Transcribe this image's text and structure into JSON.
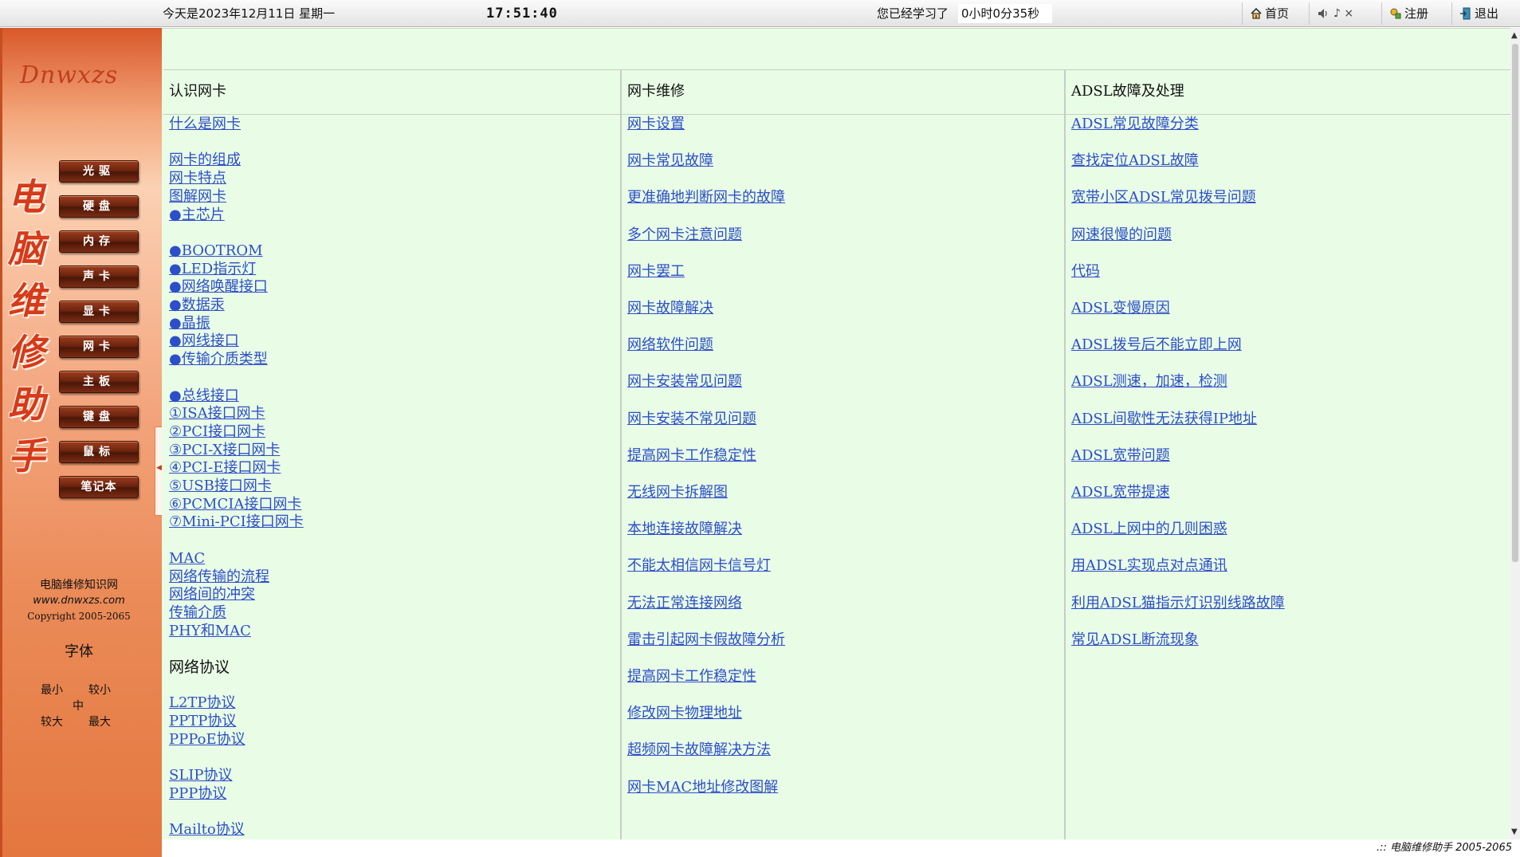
{
  "topbar": {
    "date_text": "今天是2023年12月11日 星期一",
    "clock": "17:51:40",
    "study_label": "您已经学习了",
    "study_time": "0小时0分35秒",
    "home_label": "首页",
    "sound_symbols": "♪ ×",
    "register_label": "注册",
    "exit_label": "退出"
  },
  "sidebar": {
    "logo": "Dnwxzs",
    "vertical_title": [
      "电",
      "脑",
      "维",
      "修",
      "助",
      "手"
    ],
    "nav": [
      "光驱",
      "硬盘",
      "内存",
      "声卡",
      "显卡",
      "网卡",
      "主板",
      "键盘",
      "鼠标",
      "笔记本"
    ],
    "site_name": "电脑维修知识网",
    "site_url": "www.dnwxzs.com",
    "copyright": "Copyright 2005-2065",
    "font_title": "字体",
    "font_sizes": {
      "smallest": "最小",
      "smaller": "较小",
      "medium": "中",
      "larger": "较大",
      "largest": "最大"
    }
  },
  "main": {
    "columns": [
      {
        "header": "认识网卡",
        "items": [
          {
            "text": "什么是网卡",
            "type": "link",
            "row": 0
          },
          {
            "text": "网卡的组成",
            "type": "link",
            "row": 2
          },
          {
            "text": "网卡特点",
            "type": "link",
            "row": 3
          },
          {
            "text": "图解网卡",
            "type": "link",
            "row": 4
          },
          {
            "text": "●主芯片",
            "type": "link",
            "row": 5
          },
          {
            "text": "●BOOTROM",
            "type": "link",
            "row": 7
          },
          {
            "text": "●LED指示灯",
            "type": "link",
            "row": 8
          },
          {
            "text": "●网络唤醒接口",
            "type": "link",
            "row": 9
          },
          {
            "text": "●数据汞",
            "type": "link",
            "row": 10
          },
          {
            "text": "●晶振",
            "type": "link",
            "row": 11
          },
          {
            "text": "●网线接口",
            "type": "link",
            "row": 12
          },
          {
            "text": "●传输介质类型",
            "type": "link",
            "row": 13
          },
          {
            "text": "●总线接口",
            "type": "link",
            "row": 15
          },
          {
            "text": "①ISA接口网卡",
            "type": "link",
            "row": 16
          },
          {
            "text": "②PCI接口网卡",
            "type": "link",
            "row": 17
          },
          {
            "text": "③PCI-X接口网卡",
            "type": "link",
            "row": 18
          },
          {
            "text": "④PCI-E接口网卡",
            "type": "link",
            "row": 19
          },
          {
            "text": "⑤USB接口网卡",
            "type": "link",
            "row": 20
          },
          {
            "text": "⑥PCMCIA接口网卡",
            "type": "link",
            "row": 21
          },
          {
            "text": "⑦Mini-PCI接口网卡",
            "type": "link",
            "row": 22
          },
          {
            "text": "MAC",
            "type": "link",
            "row": 24
          },
          {
            "text": "网络传输的流程",
            "type": "link",
            "row": 25
          },
          {
            "text": "网络间的冲突",
            "type": "link",
            "row": 26
          },
          {
            "text": "传输介质",
            "type": "link",
            "row": 27
          },
          {
            "text": "PHY和MAC",
            "type": "link",
            "row": 28
          },
          {
            "text": "网络协议",
            "type": "text",
            "row": 30
          },
          {
            "text": "L2TP协议",
            "type": "link",
            "row": 32
          },
          {
            "text": "PPTP协议",
            "type": "link",
            "row": 33
          },
          {
            "text": "PPPoE协议",
            "type": "link",
            "row": 34
          },
          {
            "text": "SLIP协议",
            "type": "link",
            "row": 36
          },
          {
            "text": "PPP协议",
            "type": "link",
            "row": 37
          },
          {
            "text": "Mailto协议",
            "type": "link",
            "row": 39
          }
        ]
      },
      {
        "header": "网卡维修",
        "items": [
          {
            "text": "网卡设置",
            "type": "link",
            "row": 0
          },
          {
            "text": "网卡常见故障",
            "type": "link",
            "row": 1
          },
          {
            "text": "更准确地判断网卡的故障",
            "type": "link",
            "row": 2
          },
          {
            "text": "多个网卡注意问题",
            "type": "link",
            "row": 3
          },
          {
            "text": "网卡罢工",
            "type": "link",
            "row": 4
          },
          {
            "text": "网卡故障解决",
            "type": "link",
            "row": 5
          },
          {
            "text": "网络软件问题",
            "type": "link",
            "row": 6
          },
          {
            "text": "网卡安装常见问题",
            "type": "link",
            "row": 7
          },
          {
            "text": "网卡安装不常见问题",
            "type": "link",
            "row": 8
          },
          {
            "text": "提高网卡工作稳定性",
            "type": "link",
            "row": 9
          },
          {
            "text": "无线网卡拆解图",
            "type": "link",
            "row": 10
          },
          {
            "text": "本地连接故障解决",
            "type": "link",
            "row": 11
          },
          {
            "text": "不能太相信网卡信号灯",
            "type": "link",
            "row": 12
          },
          {
            "text": "无法正常连接网络",
            "type": "link",
            "row": 13
          },
          {
            "text": "雷击引起网卡假故障分析",
            "type": "link",
            "row": 14
          },
          {
            "text": "提高网卡工作稳定性",
            "type": "link",
            "row": 15
          },
          {
            "text": "修改网卡物理地址",
            "type": "link",
            "row": 16
          },
          {
            "text": "超频网卡故障解决方法",
            "type": "link",
            "row": 17
          },
          {
            "text": "网卡MAC地址修改图解",
            "type": "link",
            "row": 18
          }
        ]
      },
      {
        "header": "ADSL故障及处理",
        "items": [
          {
            "text": "ADSL常见故障分类",
            "type": "link",
            "row": 0
          },
          {
            "text": "查找定位ADSL故障",
            "type": "link",
            "row": 1
          },
          {
            "text": "宽带小区ADSL常见拨号问题",
            "type": "link",
            "row": 2
          },
          {
            "text": "网速很慢的问题",
            "type": "link",
            "row": 3
          },
          {
            "text": "代码",
            "type": "link",
            "row": 4
          },
          {
            "text": "ADSL变慢原因",
            "type": "link",
            "row": 5
          },
          {
            "text": "ADSL拨号后不能立即上网",
            "type": "link",
            "row": 6
          },
          {
            "text": "ADSL测速，加速，检测",
            "type": "link",
            "row": 7
          },
          {
            "text": "ADSL间歇性无法获得IP地址",
            "type": "link",
            "row": 8
          },
          {
            "text": "ADSL宽带问题",
            "type": "link",
            "row": 9
          },
          {
            "text": "ADSL宽带提速",
            "type": "link",
            "row": 10
          },
          {
            "text": "ADSL上网中的几则困惑",
            "type": "link",
            "row": 11
          },
          {
            "text": "用ADSL实现点对点通讯",
            "type": "link",
            "row": 12
          },
          {
            "text": "利用ADSL猫指示灯识别线路故障",
            "type": "link",
            "row": 13
          },
          {
            "text": "常见ADSL断流现象",
            "type": "link",
            "row": 14
          }
        ]
      }
    ]
  },
  "footer": ".:: 电脑维修助手 2005-2065",
  "colors": {
    "sidebar_accent": "#e4763f",
    "content_bg": "#e9fde6",
    "link": "#2d4ec9",
    "nav_button": "#6e2410"
  }
}
